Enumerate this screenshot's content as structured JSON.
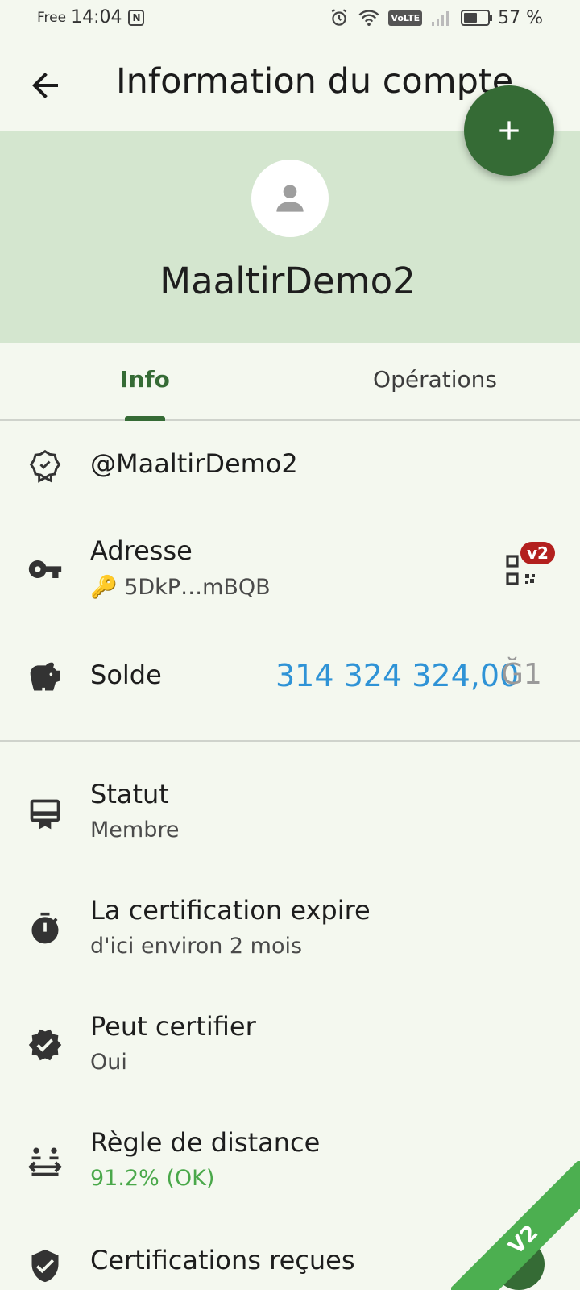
{
  "status_bar": {
    "carrier": "Free",
    "time": "14:04",
    "nfc": "N",
    "volte": "VoLTE",
    "battery_level": 0.57,
    "battery_text": "57 %"
  },
  "app_bar": {
    "title": "Information du compte"
  },
  "header": {
    "username": "MaaltirDemo2"
  },
  "tabs": [
    {
      "label": "Info",
      "selected": true
    },
    {
      "label": "Opérations",
      "selected": false
    }
  ],
  "identity": {
    "handle": "@MaaltirDemo2"
  },
  "address": {
    "title": "Adresse",
    "value": "🔑 5DkP…mBQB",
    "badge": "v2"
  },
  "balance": {
    "title": "Solde",
    "amount": "314 324 324,00",
    "unit": "Ğ1"
  },
  "status": {
    "title": "Statut",
    "value": "Membre"
  },
  "certification_expiry": {
    "title": "La certification expire",
    "value": "d'ici environ 2 mois"
  },
  "can_certify": {
    "title": "Peut certifier",
    "value": "Oui"
  },
  "distance_rule": {
    "title": "Règle de distance",
    "value": "91.2% (OK)"
  },
  "certs_received": {
    "title": "Certifications reçues"
  },
  "ribbon": {
    "label": "V2"
  },
  "colors": {
    "primary": "#356b35",
    "header_bg": "#d4e6cf",
    "page_bg": "#f4f8ef",
    "balance": "#2f93d6",
    "ok": "#4aa84a",
    "badge": "#b3201e",
    "ribbon": "#4caf50"
  }
}
